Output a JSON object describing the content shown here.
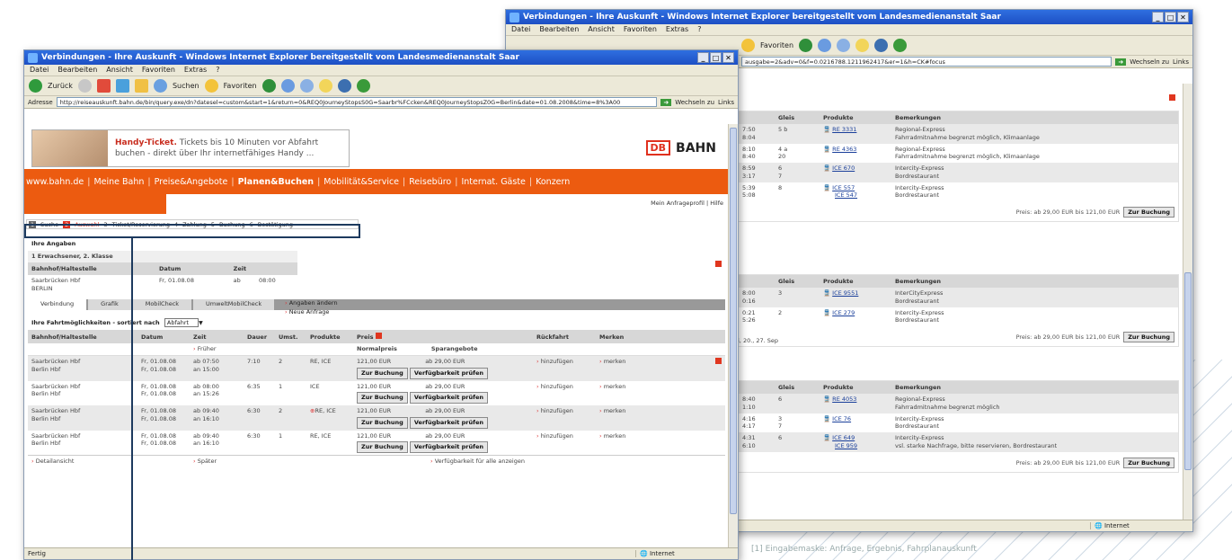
{
  "back_window": {
    "title": "Verbindungen - Ihre Auskunft - Windows Internet Explorer bereitgestellt vom Landesmedienanstalt Saar",
    "menu": [
      "Datei",
      "Bearbeiten",
      "Ansicht",
      "Favoriten",
      "Extras",
      "?"
    ],
    "toolbar_favoriten": "Favoriten",
    "address": "ausgabe=2&adv=0&f=0.0216788.1211962417&er=1&h=CK#focus",
    "wechseln_label": "Wechseln zu",
    "links_label": "Links",
    "status_zone": "Internet",
    "columns": [
      "Gleis",
      "Produkte",
      "Bemerkungen"
    ],
    "price_text": "Preis: ab 29,00 EUR bis 121,00 EUR",
    "book_button": "Zur Buchung",
    "date_fragment": "i, 20., 27. Sep",
    "sections": [
      {
        "rows": [
          {
            "times": "7:50\n8:04",
            "gleis": "5 b",
            "products": [
              "RE 3331"
            ],
            "remark": "Regional-Express\nFahrradmitnahme begrenzt möglich, Klimaanlage"
          },
          {
            "times": "8:10\n8:40",
            "gleis": "4 a\n20",
            "products": [
              "RE 4363"
            ],
            "remark": "Regional-Express\nFahrradmitnahme begrenzt möglich, Klimaanlage"
          },
          {
            "times": "8:59\n3:17",
            "gleis": "6\n7",
            "products": [
              "ICE 670"
            ],
            "remark": "Intercity-Express\nBordrestaurant"
          },
          {
            "times": "5:39\n5:08",
            "gleis": "8",
            "products": [
              "ICE 557",
              "ICE 547"
            ],
            "remark": "Intercity-Express\nBordrestaurant"
          }
        ]
      },
      {
        "rows": [
          {
            "times": "8:00\n0:16",
            "gleis": "3",
            "products": [
              "ICE 9551"
            ],
            "remark": "InterCityExpress\nBordrestaurant"
          },
          {
            "times": "0:21\n5:26",
            "gleis": "2",
            "products": [
              "ICE 279"
            ],
            "remark": "Intercity-Express\nBordrestaurant"
          }
        ]
      },
      {
        "rows": [
          {
            "times": "8:40\n1:10",
            "gleis": "6",
            "products": [
              "RE 4053"
            ],
            "remark": "Regional-Express\nFahrradmitnahme begrenzt möglich"
          },
          {
            "times": "4:16\n4:17",
            "gleis": "3\n7",
            "products": [
              "ICE 76"
            ],
            "remark": "Intercity-Express\nBordrestaurant"
          },
          {
            "times": "4:31\n6:10",
            "gleis": "6",
            "products": [
              "ICE 649",
              "ICE 959"
            ],
            "remark": "Intercity-Express\nvsl. starke Nachfrage, bitte reservieren, Bordrestaurant"
          }
        ]
      }
    ]
  },
  "front_window": {
    "title": "Verbindungen - Ihre Auskunft - Windows Internet Explorer bereitgestellt vom Landesmedienanstalt Saar",
    "menu": [
      "Datei",
      "Bearbeiten",
      "Ansicht",
      "Favoriten",
      "Extras",
      "?"
    ],
    "toolbar": {
      "back": "Zurück",
      "search": "Suchen",
      "favorites": "Favoriten"
    },
    "address_label": "Adresse",
    "address": "http://reiseauskunft.bahn.de/bin/query.exe/dn?datesel=custom&start=1&return=0&REQ0JourneyStopsS0G=Saarbr%FCcken&REQ0JourneyStopsZ0G=Berlin&date=01.08.2008&time=8%3A00",
    "wechseln_label": "Wechseln zu",
    "links_label": "Links",
    "status_left": "Fertig",
    "status_zone": "Internet",
    "promo": {
      "bold": "Handy-Ticket.",
      "line1": " Tickets bis 10 Minuten vor Abfahrt",
      "line2": "buchen - direkt über Ihr internetfähiges Handy ..."
    },
    "logo_db": "DB",
    "logo_bahn": "BAHN",
    "nav": [
      "www.bahn.de",
      "Meine Bahn",
      "Preise&Angebote",
      "Planen&Buchen",
      "Mobilität&Service",
      "Reisebüro",
      "Internat. Gäste",
      "Konzern"
    ],
    "nav_active": "Planen&Buchen",
    "subnav_right": "Mein Anfrageprofil | Hilfe",
    "steps": [
      {
        "num": "1",
        "label": "Suche"
      },
      {
        "num": "2",
        "label": "Auswahl"
      },
      {
        "num": "3",
        "label": "Ticket/Reservierung"
      },
      {
        "num": "4",
        "label": "Zahlung"
      },
      {
        "num": "5",
        "label": "Buchung"
      },
      {
        "num": "6",
        "label": "Bestätigung"
      }
    ],
    "inputs_title": "Ihre Angaben",
    "passenger": "1 Erwachsener, 2. Klasse",
    "inputs_cols": [
      "Bahnhof/Haltestelle",
      "Datum",
      "Zeit"
    ],
    "inputs_from": "Saarbrücken Hbf",
    "inputs_to": "BERLIN",
    "inputs_date": "Fr, 01.08.08",
    "inputs_ab": "ab",
    "inputs_time": "08:00",
    "change_link": "Angaben ändern",
    "new_link": "Neue Anfrage",
    "tabs": [
      "Verbindung",
      "Grafik",
      "MobilCheck",
      "UmweltMobilCheck"
    ],
    "results_title": "Ihre Fahrtmöglichkeiten - sortiert nach",
    "sort_value": "Abfahrt",
    "cols": [
      "Bahnhof/Haltestelle",
      "Datum",
      "Zeit",
      "Dauer",
      "Umst.",
      "Produkte",
      "Preis",
      "Rückfahrt",
      "Merken"
    ],
    "price_sub": [
      "Normalpreis",
      "Sparangebote"
    ],
    "earlier": "Früher",
    "later": "Später",
    "detail_link": "Detailansicht",
    "avail_all": "Verfügbarkeit für alle anzeigen",
    "book_button": "Zur Buchung",
    "check_button": "Verfügbarkeit prüfen",
    "add_link": "hinzufügen",
    "remember_link": "merken",
    "rows": [
      {
        "from": "Saarbrücken Hbf",
        "to": "Berlin Hbf",
        "d1": "Fr, 01.08.08",
        "d2": "Fr, 01.08.08",
        "t1": "07:50",
        "t2": "15:00",
        "dur": "7:10",
        "chg": "2",
        "prod": "RE, ICE",
        "norm": "121,00 EUR",
        "spar": "ab 29,00 EUR"
      },
      {
        "from": "Saarbrücken Hbf",
        "to": "Berlin Hbf",
        "d1": "Fr, 01.08.08",
        "d2": "Fr, 01.08.08",
        "t1": "08:00",
        "t2": "15:26",
        "dur": "6:35",
        "chg": "1",
        "prod": "ICE",
        "norm": "121,00 EUR",
        "spar": "ab 29,00 EUR"
      },
      {
        "from": "Saarbrücken Hbf",
        "to": "Berlin Hbf",
        "d1": "Fr, 01.08.08",
        "d2": "Fr, 01.08.08",
        "t1": "09:40",
        "t2": "16:10",
        "dur": "6:30",
        "chg": "2",
        "prod": "RE, ICE",
        "norm": "121,00 EUR",
        "spar": "ab 29,00 EUR"
      },
      {
        "from": "Saarbrücken Hbf",
        "to": "Berlin Hbf",
        "d1": "Fr, 01.08.08",
        "d2": "Fr, 01.08.08",
        "t1": "09:40",
        "t2": "16:10",
        "dur": "6:30",
        "chg": "1",
        "prod": "RE, ICE",
        "norm": "121,00 EUR",
        "spar": "ab 29,00 EUR"
      }
    ],
    "ab": "ab",
    "an": "an"
  },
  "caption": "[1] Eingabemaske: Anfrage, Ergebnis, Fahrplanauskunft",
  "colors": {
    "db_red": "#e0301e",
    "nav_orange": "#ec5b10",
    "ie_blue": "#2f6fe0"
  }
}
